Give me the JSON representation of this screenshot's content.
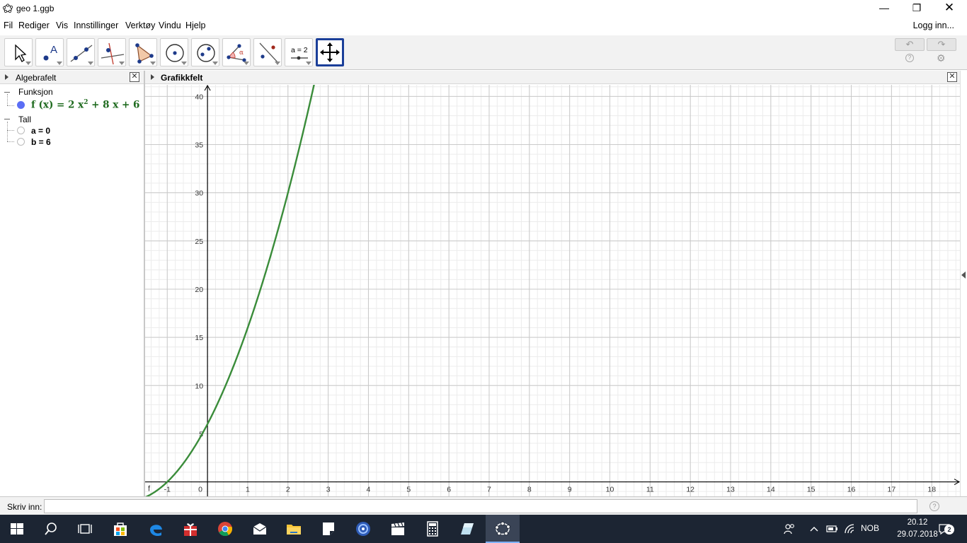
{
  "window": {
    "title": "geo 1.ggb",
    "minimize_icon": "—",
    "maximize_icon": "❐",
    "close_icon": "✕"
  },
  "menu": {
    "items": [
      "Fil",
      "Rediger",
      "Vis",
      "Innstillinger",
      "Verktøy",
      "Vindu",
      "Hjelp"
    ],
    "login": "Logg inn..."
  },
  "toolbar": {
    "tools": [
      "move",
      "point",
      "line",
      "perpendicular-line",
      "polygon",
      "circle",
      "ellipse",
      "angle",
      "reflect",
      "slider",
      "move-graphics-view"
    ],
    "selected_tool": "move-graphics-view",
    "slider_tool_label": "a = 2",
    "undo_icon": "↶",
    "redo_icon": "↷",
    "help_icon": "?",
    "settings_icon": "⚙"
  },
  "algebra": {
    "title": "Algebrafelt",
    "close_icon": "✕",
    "groups": [
      {
        "label": "Funksjon",
        "items": [
          {
            "lhs": "f (x)  =  2 x",
            "exp": "2",
            "rhs": " + 8 x + 6",
            "color": "#1f6b1f",
            "dot_color": "#5b6ef5"
          }
        ]
      },
      {
        "label": "Tall",
        "items": [
          {
            "text": "a = 0"
          },
          {
            "text": "b = 6"
          }
        ]
      }
    ]
  },
  "graphics": {
    "title": "Grafikkfelt",
    "close_icon": "✕",
    "function_label": "f",
    "function": {
      "a": 2,
      "b": 8,
      "c": 6
    },
    "curve_color": "#3a8c3a",
    "x_range": [
      -1.55,
      18.7
    ],
    "y_range": [
      -1.5,
      41.2
    ],
    "x_ticks": [
      "-1",
      "0",
      "1",
      "2",
      "3",
      "4",
      "5",
      "6",
      "7",
      "8",
      "9",
      "10",
      "11",
      "12",
      "13",
      "14",
      "15",
      "16",
      "17",
      "18"
    ],
    "y_ticks": [
      "5",
      "10",
      "15",
      "20",
      "25",
      "30",
      "35",
      "40"
    ]
  },
  "input": {
    "label": "Skriv inn:",
    "value": "",
    "help_icon": "?"
  },
  "taskbar": {
    "apps": [
      "windows-start",
      "search",
      "task-view",
      "store",
      "edge",
      "gift",
      "chrome",
      "mail",
      "file-explorer",
      "sticky-notes",
      "media-player",
      "movies",
      "calculator",
      "eraser-app",
      "geogebra"
    ],
    "running_app": "geogebra",
    "tray_language": "NOB",
    "clock_time": "20.12",
    "clock_date": "29.07.2018",
    "notification_count": "2"
  }
}
